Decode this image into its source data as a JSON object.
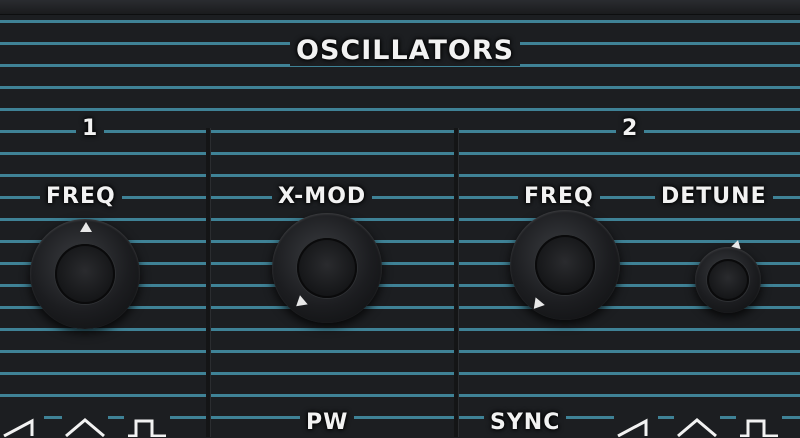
{
  "section": {
    "title": "OSCILLATORS"
  },
  "osc1": {
    "number": "1",
    "freq_label": "FREQ"
  },
  "mod": {
    "xmod_label": "X-MOD",
    "pw_label": "PW"
  },
  "osc2": {
    "number": "2",
    "freq_label": "FREQ",
    "detune_label": "DETUNE",
    "sync_label": "SYNC"
  },
  "waveforms": {
    "osc1": [
      "sawtooth-icon",
      "triangle-icon",
      "square-icon"
    ],
    "osc2": [
      "sawtooth-icon",
      "triangle-icon",
      "square-icon"
    ]
  },
  "colors": {
    "stripe": "#3f8296",
    "background": "#1c1e21",
    "text": "#f2f2f2"
  }
}
